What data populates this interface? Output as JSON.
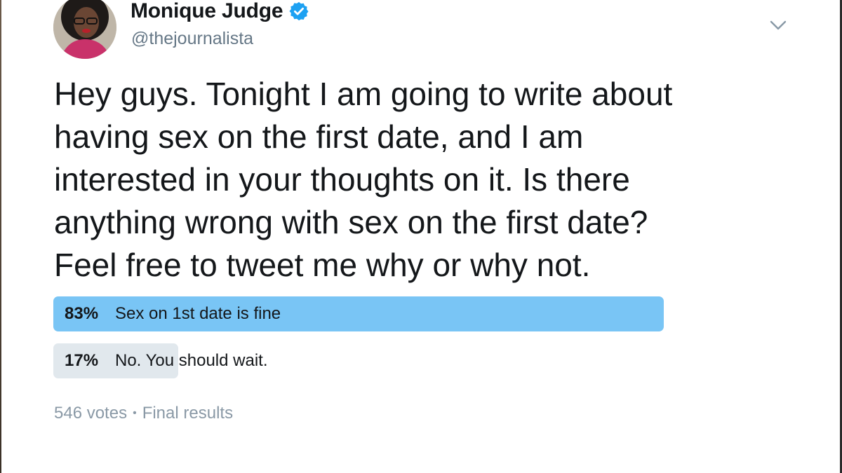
{
  "author": {
    "display_name": "Monique Judge",
    "handle": "@thejournalista",
    "verified_icon": "verified-badge-icon",
    "avatar_icon": "avatar"
  },
  "menu": {
    "caret_icon": "chevron-down-icon"
  },
  "tweet": {
    "text": "Hey guys. Tonight I am going to write about\nhaving sex on the first date, and I am\ninterested in your thoughts on it. Is there\nanything wrong with sex on the first date?\nFeel free to tweet me why or why not."
  },
  "poll": {
    "options": [
      {
        "percent": "83%",
        "label": "Sex on 1st date is fine",
        "share": 0.83,
        "winner": true
      },
      {
        "percent": "17%",
        "label": "No. You should wait.",
        "share": 0.17,
        "winner": false
      }
    ],
    "votes": "546 votes",
    "separator": "•",
    "status": "Final results"
  },
  "colors": {
    "winner_bar": "#79c5f5",
    "loser_bar": "#e1e8ed",
    "verified_blue": "#1da1f2",
    "secondary_text": "#657786"
  }
}
